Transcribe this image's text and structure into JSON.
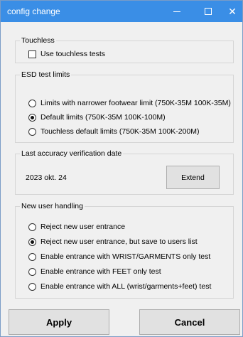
{
  "window": {
    "title": "config change",
    "minimize_glyph": "",
    "maximize_glyph": "",
    "close_glyph": "✕"
  },
  "touchless": {
    "title": "Touchless",
    "checkbox_label": "Use touchless tests",
    "checked": false
  },
  "esd": {
    "title": "ESD test limits",
    "options": [
      {
        "label": "Limits with narrower footwear limit (750K-35M 100K-35M)",
        "selected": false
      },
      {
        "label": "Default limits (750K-35M 100K-100M)",
        "selected": true
      },
      {
        "label": "Touchless default limits (750K-35M 100K-200M)",
        "selected": false
      }
    ]
  },
  "accuracy": {
    "title": "Last accuracy verification date",
    "date": "2023 okt. 24",
    "extend_label": "Extend"
  },
  "new_user": {
    "title": "New user handling",
    "options": [
      {
        "label": "Reject new user entrance",
        "selected": false
      },
      {
        "label": "Reject new user entrance, but save to users list",
        "selected": true
      },
      {
        "label": "Enable entrance with WRIST/GARMENTS only test",
        "selected": false
      },
      {
        "label": "Enable entrance with FEET only test",
        "selected": false
      },
      {
        "label": "Enable entrance with ALL (wrist/garments+feet) test",
        "selected": false
      }
    ]
  },
  "actions": {
    "apply_label": "Apply",
    "cancel_label": "Cancel"
  },
  "colors": {
    "titlebar": "#3a8ee6",
    "window_bg": "#f0f0f0"
  }
}
